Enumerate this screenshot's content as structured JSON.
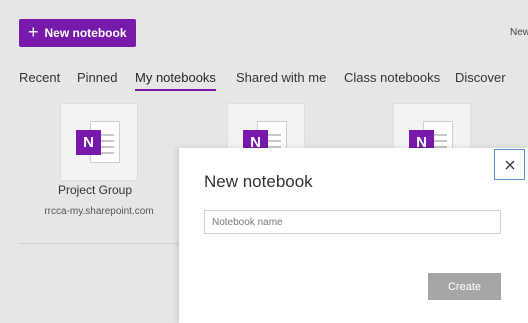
{
  "toolbar": {
    "new_notebook_label": "New notebook",
    "new_notebook_icon": "plus-icon",
    "top_right_text": "New"
  },
  "tabs": [
    {
      "label": "Recent"
    },
    {
      "label": "Pinned"
    },
    {
      "label": "My notebooks",
      "active": true
    },
    {
      "label": "Shared with me"
    },
    {
      "label": "Class notebooks"
    },
    {
      "label": "Discover"
    }
  ],
  "notebooks": [
    {
      "icon_letter": "N",
      "title": "Project Group",
      "location": "rrcca-my.sharepoint.com"
    },
    {
      "icon_letter": "N"
    },
    {
      "icon_letter": "N"
    }
  ],
  "dialog": {
    "title": "New notebook",
    "name_placeholder": "Notebook name",
    "name_value": "",
    "create_label": "Create",
    "close_icon": "close-icon"
  },
  "colors": {
    "accent": "#7719aa",
    "background": "#e6e6e6",
    "disabled_button": "#a6a6a6",
    "focus_border": "#5b8fd6"
  }
}
